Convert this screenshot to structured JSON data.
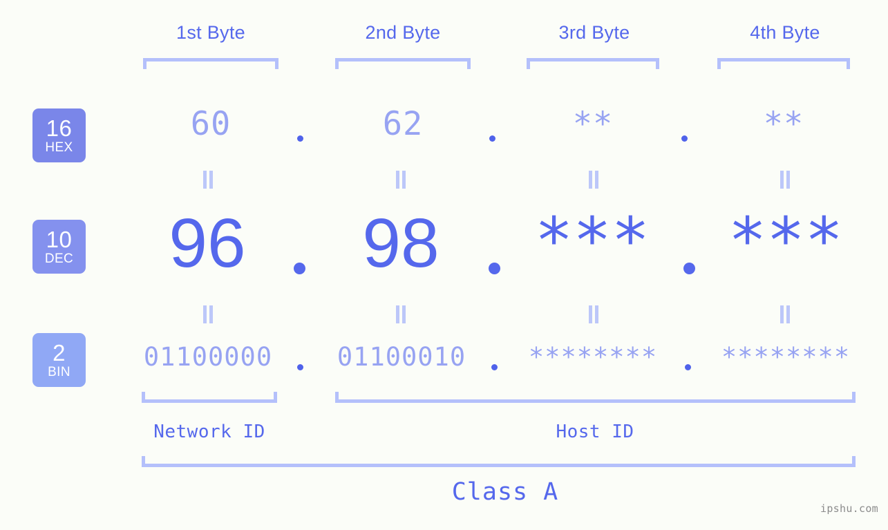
{
  "meta": {
    "background_color": "#fbfdf8",
    "accent_color": "#5568ec",
    "muted_color": "#97a3f2",
    "bracket_color": "#b4c0fb"
  },
  "headers": {
    "bytes": [
      {
        "label": "1st Byte"
      },
      {
        "label": "2nd Byte"
      },
      {
        "label": "3rd Byte"
      },
      {
        "label": "4th Byte"
      }
    ]
  },
  "radix_badges": [
    {
      "number": "16",
      "name": "HEX",
      "color": "#7a86e9"
    },
    {
      "number": "10",
      "name": "DEC",
      "color": "#8491ee"
    },
    {
      "number": "2",
      "name": "BIN",
      "color": "#90a8f5"
    }
  ],
  "rows": {
    "hex": {
      "radix": "16",
      "radix_name": "HEX",
      "values": [
        "60",
        "62",
        "**",
        "**"
      ],
      "separator": "."
    },
    "dec": {
      "radix": "10",
      "radix_name": "DEC",
      "values": [
        "96",
        "98",
        "***",
        "***"
      ],
      "separator": "."
    },
    "bin": {
      "radix": "2",
      "radix_name": "BIN",
      "values": [
        "01100000",
        "01100010",
        "********",
        "********"
      ],
      "separator": "."
    }
  },
  "equality_marks": {
    "glyph": "=",
    "count_per_row": 4
  },
  "id_sections": [
    {
      "label": "Network ID"
    },
    {
      "label": "Host ID"
    }
  ],
  "class_section": {
    "label": "Class A"
  },
  "watermark": {
    "text": "ipshu.com"
  }
}
